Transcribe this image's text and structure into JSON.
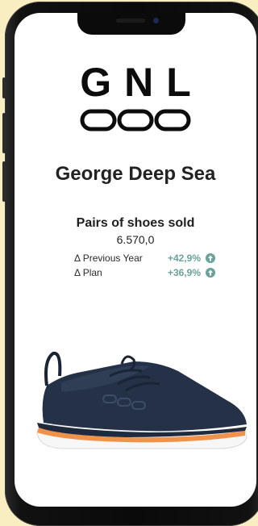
{
  "colors": {
    "background": "#f8eec2",
    "delta_positive": "#6aa39b"
  },
  "brand": {
    "logo_text": "GNL"
  },
  "product": {
    "name": "George Deep Sea"
  },
  "metric": {
    "label": "Pairs of shoes sold",
    "value": "6.570,0",
    "deltas": [
      {
        "label": "Δ Previous Year",
        "value": "+42,9%",
        "icon": "arrow-up-circle-icon"
      },
      {
        "label": "Δ Plan",
        "value": "+36,9%",
        "icon": "arrow-up-circle-icon"
      }
    ]
  },
  "image": {
    "icon": "sneaker-image"
  }
}
